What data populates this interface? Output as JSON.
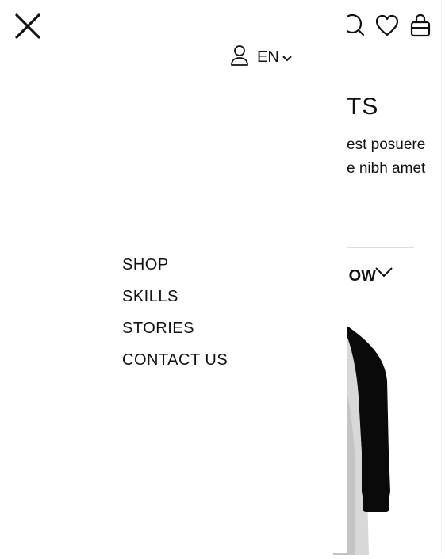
{
  "drawer": {
    "close_icon": "close-icon",
    "account_icon": "user-icon",
    "language": {
      "selected": "EN",
      "icon": "chevron-down-icon"
    },
    "nav": [
      {
        "label": "SHOP"
      },
      {
        "label": "SKILLS"
      },
      {
        "label": "STORIES"
      },
      {
        "label": "CONTACT US"
      }
    ]
  },
  "background": {
    "header_icons": [
      "search-icon",
      "heart-icon",
      "bag-icon"
    ],
    "title_fragment": "TS",
    "description_fragment_1": "est posuere",
    "description_fragment_2": "e nibh amet",
    "sort_label_fragment": "OW",
    "product_image": "long-sleeve-shirt"
  },
  "colors": {
    "text": "#111111",
    "background": "#ffffff",
    "divider": "#dddddd"
  }
}
